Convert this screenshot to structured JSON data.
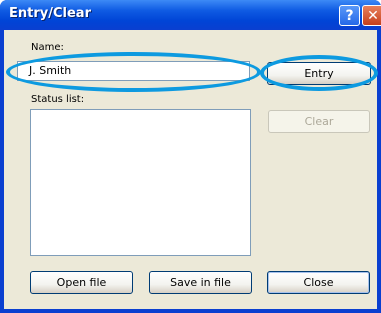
{
  "window": {
    "title": "Entry/Clear",
    "help_glyph": "?",
    "close_glyph": "✕"
  },
  "form": {
    "name_label": "Name:",
    "name_value": "J. Smith",
    "status_label": "Status list:"
  },
  "buttons": {
    "entry": "Entry",
    "clear": "Clear",
    "open_file": "Open file",
    "save_in_file": "Save in file",
    "close": "Close"
  },
  "colors": {
    "highlight": "#0d9ae0",
    "titlebar": "#0a3fd0"
  }
}
